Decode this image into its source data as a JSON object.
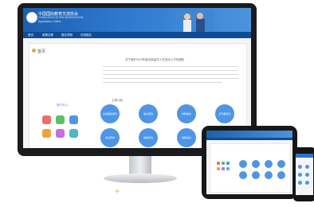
{
  "site": {
    "title_cn": "中国国际教育交流协会",
    "subtitle_en": "CHINA EDUCATION ASSOCIATION",
    "subtitle_en2": "Application Online",
    "nav": [
      "首页",
      "政策法规",
      "报名须知",
      "在线报名",
      "联系我们"
    ]
  },
  "main": {
    "section_title": "首页",
    "doc_title": "关于做好2015年度出国留学人员选派工作的通知",
    "sidebar_label": "用户中心",
    "sub_label": "主要功能",
    "bubbles": [
      "在线报名填写",
      "信息查询",
      "材料提交",
      "打印报名表",
      "考试安排",
      "成绩查询",
      "录取信息",
      "通知公告"
    ]
  },
  "colors": {
    "header": "#1d5fae",
    "nav": "#0f4c96",
    "bubble": "#4f95e6",
    "apps": [
      "#ee6d6d",
      "#5bbf6b",
      "#4f95e6",
      "#f2a03c",
      "#c96ce0",
      "#4ab9c9"
    ]
  }
}
